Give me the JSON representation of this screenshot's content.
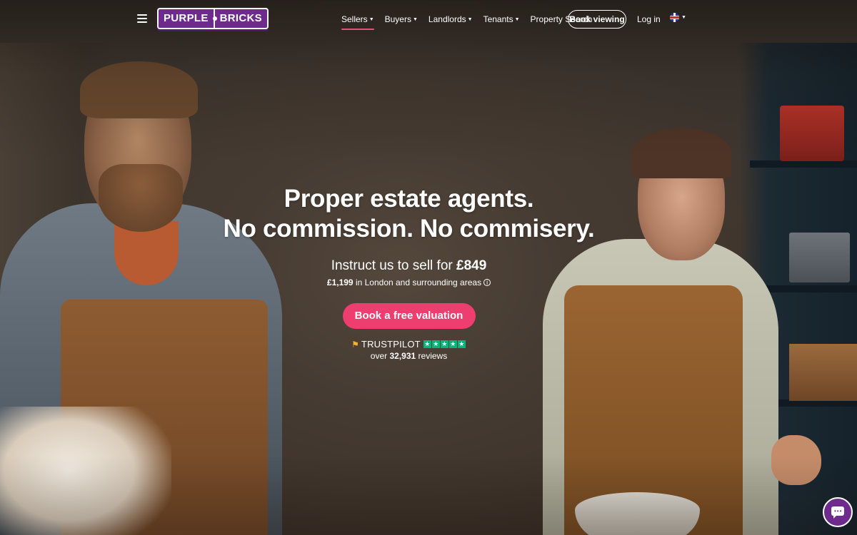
{
  "nav": {
    "logo": {
      "left": "PURPLE",
      "right": "BRICKS"
    },
    "items": [
      {
        "label": "Sellers",
        "has_dropdown": true,
        "active": true
      },
      {
        "label": "Buyers",
        "has_dropdown": true
      },
      {
        "label": "Landlords",
        "has_dropdown": true
      },
      {
        "label": "Tenants",
        "has_dropdown": true
      },
      {
        "label": "Property Search",
        "has_dropdown": false
      }
    ],
    "book_viewing": "Book viewing",
    "login": "Log in",
    "language_icon": "uk-flag-icon"
  },
  "hero": {
    "headline_line1": "Proper estate agents.",
    "headline_line2": "No commission. No commisery.",
    "sub_prefix": "Instruct us to sell for ",
    "sub_price": "£849",
    "london_price": "£1,199",
    "london_text": " in London and surrounding areas",
    "cta": "Book a free valuation",
    "trustpilot_name": "TRUSTPILOT",
    "trustpilot_stars": 5,
    "reviews_prefix": "over ",
    "reviews_count": "32,931",
    "reviews_suffix": " reviews"
  },
  "colors": {
    "brand_purple": "#6e2a8c",
    "cta_pink": "#ee3d6f",
    "active_underline": "#e94e7a",
    "trustpilot_green": "#00b67a"
  },
  "chat": {
    "icon": "chat-bubble-icon"
  }
}
